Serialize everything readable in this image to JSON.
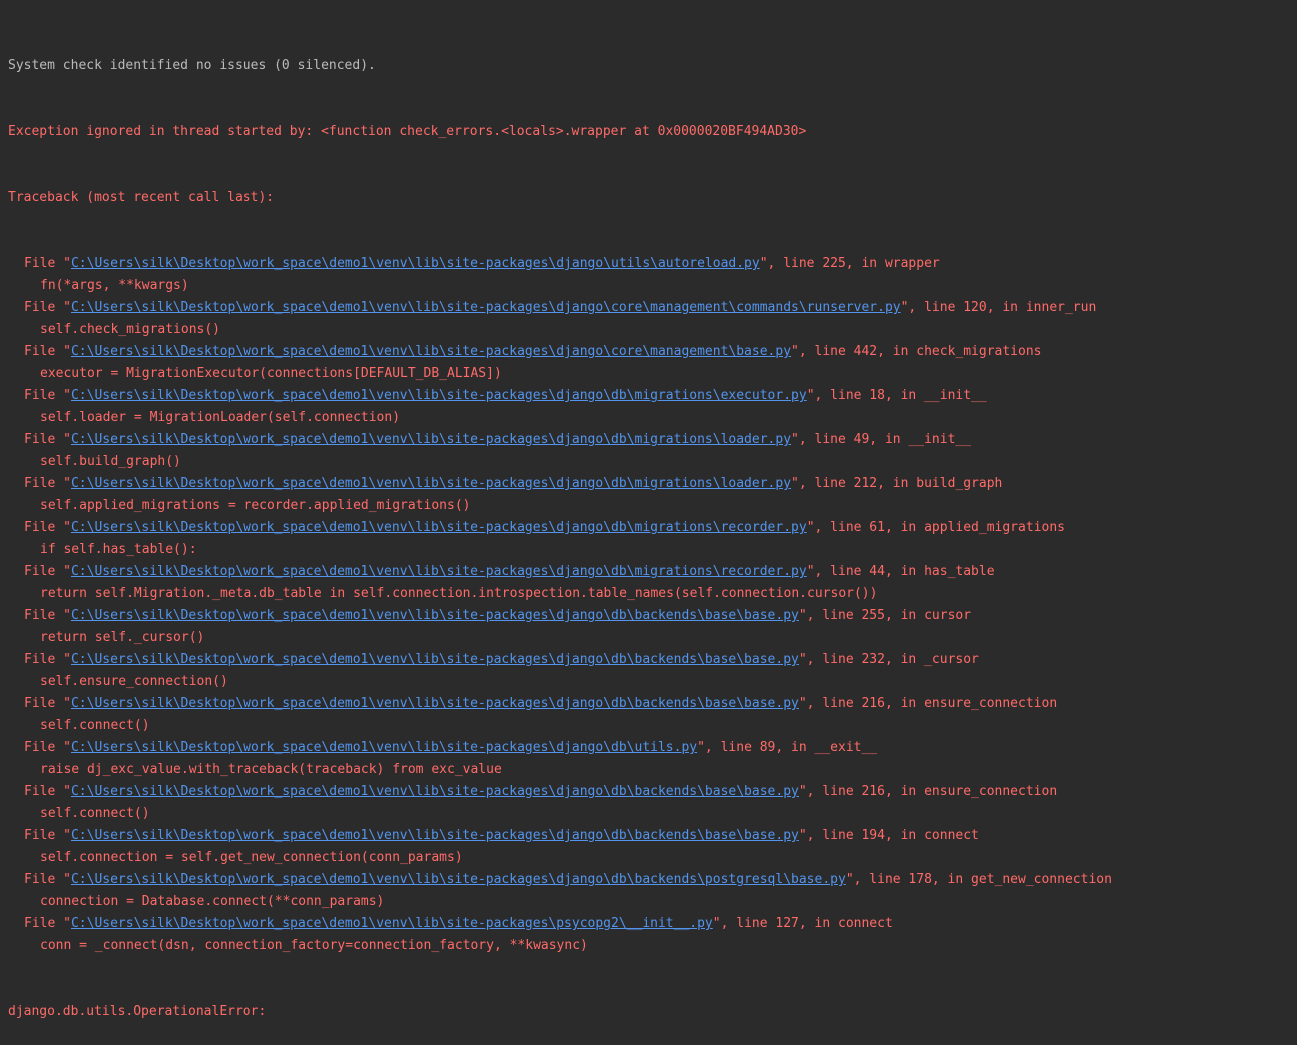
{
  "console": {
    "system_check": "System check identified no issues (0 silenced).",
    "exception_header": "Exception ignored in thread started by: <function check_errors.<locals>.wrapper at 0x0000020BF494AD30>",
    "traceback_header": "Traceback (most recent call last):",
    "frames": [
      {
        "path": "C:\\Users\\silk\\Desktop\\work_space\\demo1\\venv\\lib\\site-packages\\django\\utils\\autoreload.py",
        "location": "\", line 225, in wrapper",
        "code": "fn(*args, **kwargs)"
      },
      {
        "path": "C:\\Users\\silk\\Desktop\\work_space\\demo1\\venv\\lib\\site-packages\\django\\core\\management\\commands\\runserver.py",
        "location": "\", line 120, in inner_run",
        "code": "self.check_migrations()"
      },
      {
        "path": "C:\\Users\\silk\\Desktop\\work_space\\demo1\\venv\\lib\\site-packages\\django\\core\\management\\base.py",
        "location": "\", line 442, in check_migrations",
        "code": "executor = MigrationExecutor(connections[DEFAULT_DB_ALIAS])"
      },
      {
        "path": "C:\\Users\\silk\\Desktop\\work_space\\demo1\\venv\\lib\\site-packages\\django\\db\\migrations\\executor.py",
        "location": "\", line 18, in __init__",
        "code": "self.loader = MigrationLoader(self.connection)"
      },
      {
        "path": "C:\\Users\\silk\\Desktop\\work_space\\demo1\\venv\\lib\\site-packages\\django\\db\\migrations\\loader.py",
        "location": "\", line 49, in __init__",
        "code": "self.build_graph()"
      },
      {
        "path": "C:\\Users\\silk\\Desktop\\work_space\\demo1\\venv\\lib\\site-packages\\django\\db\\migrations\\loader.py",
        "location": "\", line 212, in build_graph",
        "code": "self.applied_migrations = recorder.applied_migrations()"
      },
      {
        "path": "C:\\Users\\silk\\Desktop\\work_space\\demo1\\venv\\lib\\site-packages\\django\\db\\migrations\\recorder.py",
        "location": "\", line 61, in applied_migrations",
        "code": "if self.has_table():"
      },
      {
        "path": "C:\\Users\\silk\\Desktop\\work_space\\demo1\\venv\\lib\\site-packages\\django\\db\\migrations\\recorder.py",
        "location": "\", line 44, in has_table",
        "code": "return self.Migration._meta.db_table in self.connection.introspection.table_names(self.connection.cursor())"
      },
      {
        "path": "C:\\Users\\silk\\Desktop\\work_space\\demo1\\venv\\lib\\site-packages\\django\\db\\backends\\base\\base.py",
        "location": "\", line 255, in cursor",
        "code": "return self._cursor()"
      },
      {
        "path": "C:\\Users\\silk\\Desktop\\work_space\\demo1\\venv\\lib\\site-packages\\django\\db\\backends\\base\\base.py",
        "location": "\", line 232, in _cursor",
        "code": "self.ensure_connection()"
      },
      {
        "path": "C:\\Users\\silk\\Desktop\\work_space\\demo1\\venv\\lib\\site-packages\\django\\db\\backends\\base\\base.py",
        "location": "\", line 216, in ensure_connection",
        "code": "self.connect()"
      },
      {
        "path": "C:\\Users\\silk\\Desktop\\work_space\\demo1\\venv\\lib\\site-packages\\django\\db\\utils.py",
        "location": "\", line 89, in __exit__",
        "code": "raise dj_exc_value.with_traceback(traceback) from exc_value"
      },
      {
        "path": "C:\\Users\\silk\\Desktop\\work_space\\demo1\\venv\\lib\\site-packages\\django\\db\\backends\\base\\base.py",
        "location": "\", line 216, in ensure_connection",
        "code": "self.connect()"
      },
      {
        "path": "C:\\Users\\silk\\Desktop\\work_space\\demo1\\venv\\lib\\site-packages\\django\\db\\backends\\base\\base.py",
        "location": "\", line 194, in connect",
        "code": "self.connection = self.get_new_connection(conn_params)"
      },
      {
        "path": "C:\\Users\\silk\\Desktop\\work_space\\demo1\\venv\\lib\\site-packages\\django\\db\\backends\\postgresql\\base.py",
        "location": "\", line 178, in get_new_connection",
        "code": "connection = Database.connect(**conn_params)"
      },
      {
        "path": "C:\\Users\\silk\\Desktop\\work_space\\demo1\\venv\\lib\\site-packages\\psycopg2\\__init__.py",
        "location": "\", line 127, in connect",
        "code": "conn = _connect(dsn, connection_factory=connection_factory, **kwasync)"
      }
    ],
    "frame_prefix": "File \"",
    "final_error": "django.db.utils.OperationalError:"
  },
  "colors": {
    "background": "#2b2b2b",
    "normal_text": "#bbbbbb",
    "error_text": "#ff6b68",
    "link": "#5394ec"
  }
}
